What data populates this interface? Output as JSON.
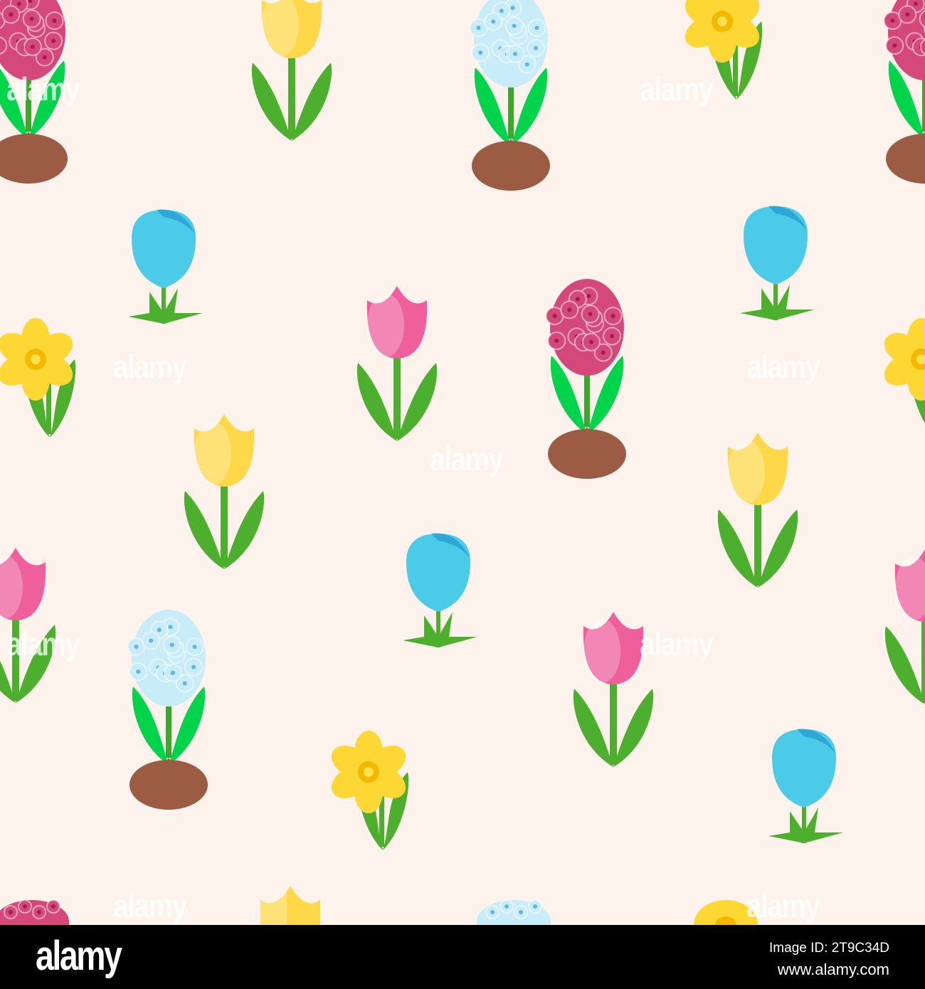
{
  "watermark": "alamy",
  "footer": {
    "logo": "alamy",
    "image_id": "Image ID: 2T9C34D",
    "website": "www.alamy.com"
  },
  "colors": {
    "background": "#fdf3ec",
    "leaf": "#4caf2e",
    "leaf_light": "#00d44a",
    "tulip_yellow": "#ffd84a",
    "tulip_pink": "#ee5f9c",
    "crocus_blue": "#4ccbe9",
    "daffodil": "#fdd835",
    "hyacinth_pink": "#d5497a",
    "hyacinth_blue": "#c8ecf8",
    "bulb": "#9b5c43"
  }
}
